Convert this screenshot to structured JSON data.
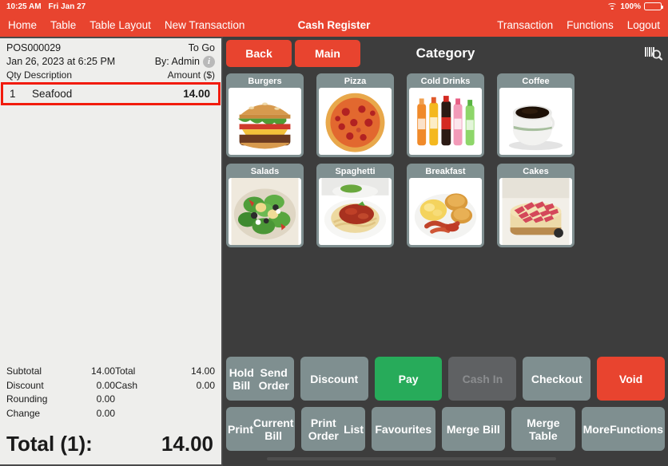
{
  "statusbar": {
    "time": "10:25 AM",
    "date": "Fri Jan 27",
    "battery_percent": "100%",
    "wifi_icon": "wifi-icon",
    "battery_icon": "battery-full-icon"
  },
  "navbar": {
    "title": "Cash Register",
    "left_items": [
      {
        "label": "Home",
        "name": "nav-home"
      },
      {
        "label": "Table",
        "name": "nav-table"
      },
      {
        "label": "Table Layout",
        "name": "nav-table-layout"
      },
      {
        "label": "New Transaction",
        "name": "nav-new-transaction"
      }
    ],
    "right_items": [
      {
        "label": "Transaction",
        "name": "nav-transaction"
      },
      {
        "label": "Functions",
        "name": "nav-functions"
      },
      {
        "label": "Logout",
        "name": "nav-logout"
      }
    ]
  },
  "receipt": {
    "order_id": "POS000029",
    "order_type": "To Go",
    "datetime": "Jan 26, 2023 at 6:25 PM",
    "operator": "By: Admin",
    "info_icon": "info-icon",
    "columns": {
      "qty": "Qty",
      "description": "Description",
      "amount": "Amount ($)"
    },
    "items": [
      {
        "qty": "1",
        "description": "Seafood",
        "amount": "14.00",
        "selected": true
      }
    ],
    "totals_left": [
      {
        "label": "Subtotal",
        "value": "14.00"
      },
      {
        "label": "Discount",
        "value": "0.00"
      },
      {
        "label": "Rounding",
        "value": "0.00"
      },
      {
        "label": "Change",
        "value": "0.00"
      }
    ],
    "totals_right": [
      {
        "label": "Total",
        "value": "14.00"
      },
      {
        "label": "Cash",
        "value": "0.00"
      }
    ],
    "grand_total_label": "Total (1):",
    "grand_total_value": "14.00",
    "selection_color": "#f21b0c"
  },
  "catalog": {
    "back_label": "Back",
    "main_label": "Main",
    "title": "Category",
    "scan_icon": "barcode-scan-icon",
    "tiles": [
      {
        "label": "Burgers",
        "art": "burger"
      },
      {
        "label": "Pizza",
        "art": "pizza"
      },
      {
        "label": "Cold Drinks",
        "art": "bottles"
      },
      {
        "label": "Coffee",
        "art": "coffee"
      },
      {
        "label": "Salads",
        "art": "salad"
      },
      {
        "label": "Spaghetti",
        "art": "spaghetti"
      },
      {
        "label": "Breakfast",
        "art": "breakfast"
      },
      {
        "label": "Cakes",
        "art": "cake"
      }
    ]
  },
  "actions": {
    "row1": [
      {
        "label": "Hold Bill\nSend Order",
        "style": "gray",
        "name": "hold-bill-send-order-button",
        "disabled": false
      },
      {
        "label": "Discount",
        "style": "gray",
        "name": "discount-button",
        "disabled": false
      },
      {
        "label": "Pay",
        "style": "green",
        "name": "pay-button",
        "disabled": false
      },
      {
        "label": "Cash In",
        "style": "disabled",
        "name": "cash-in-button",
        "disabled": true
      },
      {
        "label": "Checkout",
        "style": "gray",
        "name": "checkout-button",
        "disabled": false
      },
      {
        "label": "Void",
        "style": "red",
        "name": "void-button",
        "disabled": false
      }
    ],
    "row2": [
      {
        "label": "Print\nCurrent Bill",
        "style": "gray",
        "name": "print-current-bill-button",
        "disabled": false
      },
      {
        "label": "Print Order\nList",
        "style": "gray",
        "name": "print-order-list-button",
        "disabled": false
      },
      {
        "label": "Favourites",
        "style": "gray",
        "name": "favourites-button",
        "disabled": false
      },
      {
        "label": "Merge Bill",
        "style": "gray",
        "name": "merge-bill-button",
        "disabled": false
      },
      {
        "label": "Merge Table",
        "style": "gray",
        "name": "merge-table-button",
        "disabled": false
      },
      {
        "label": "More\nFunctions",
        "style": "gray",
        "name": "more-functions-button",
        "disabled": false
      }
    ]
  },
  "colors": {
    "accent_red": "#e8442f",
    "pay_green": "#27ab5a",
    "panel_dark": "#3d3d3d",
    "button_gray": "#7f8f90",
    "receipt_bg": "#eeeeec"
  }
}
